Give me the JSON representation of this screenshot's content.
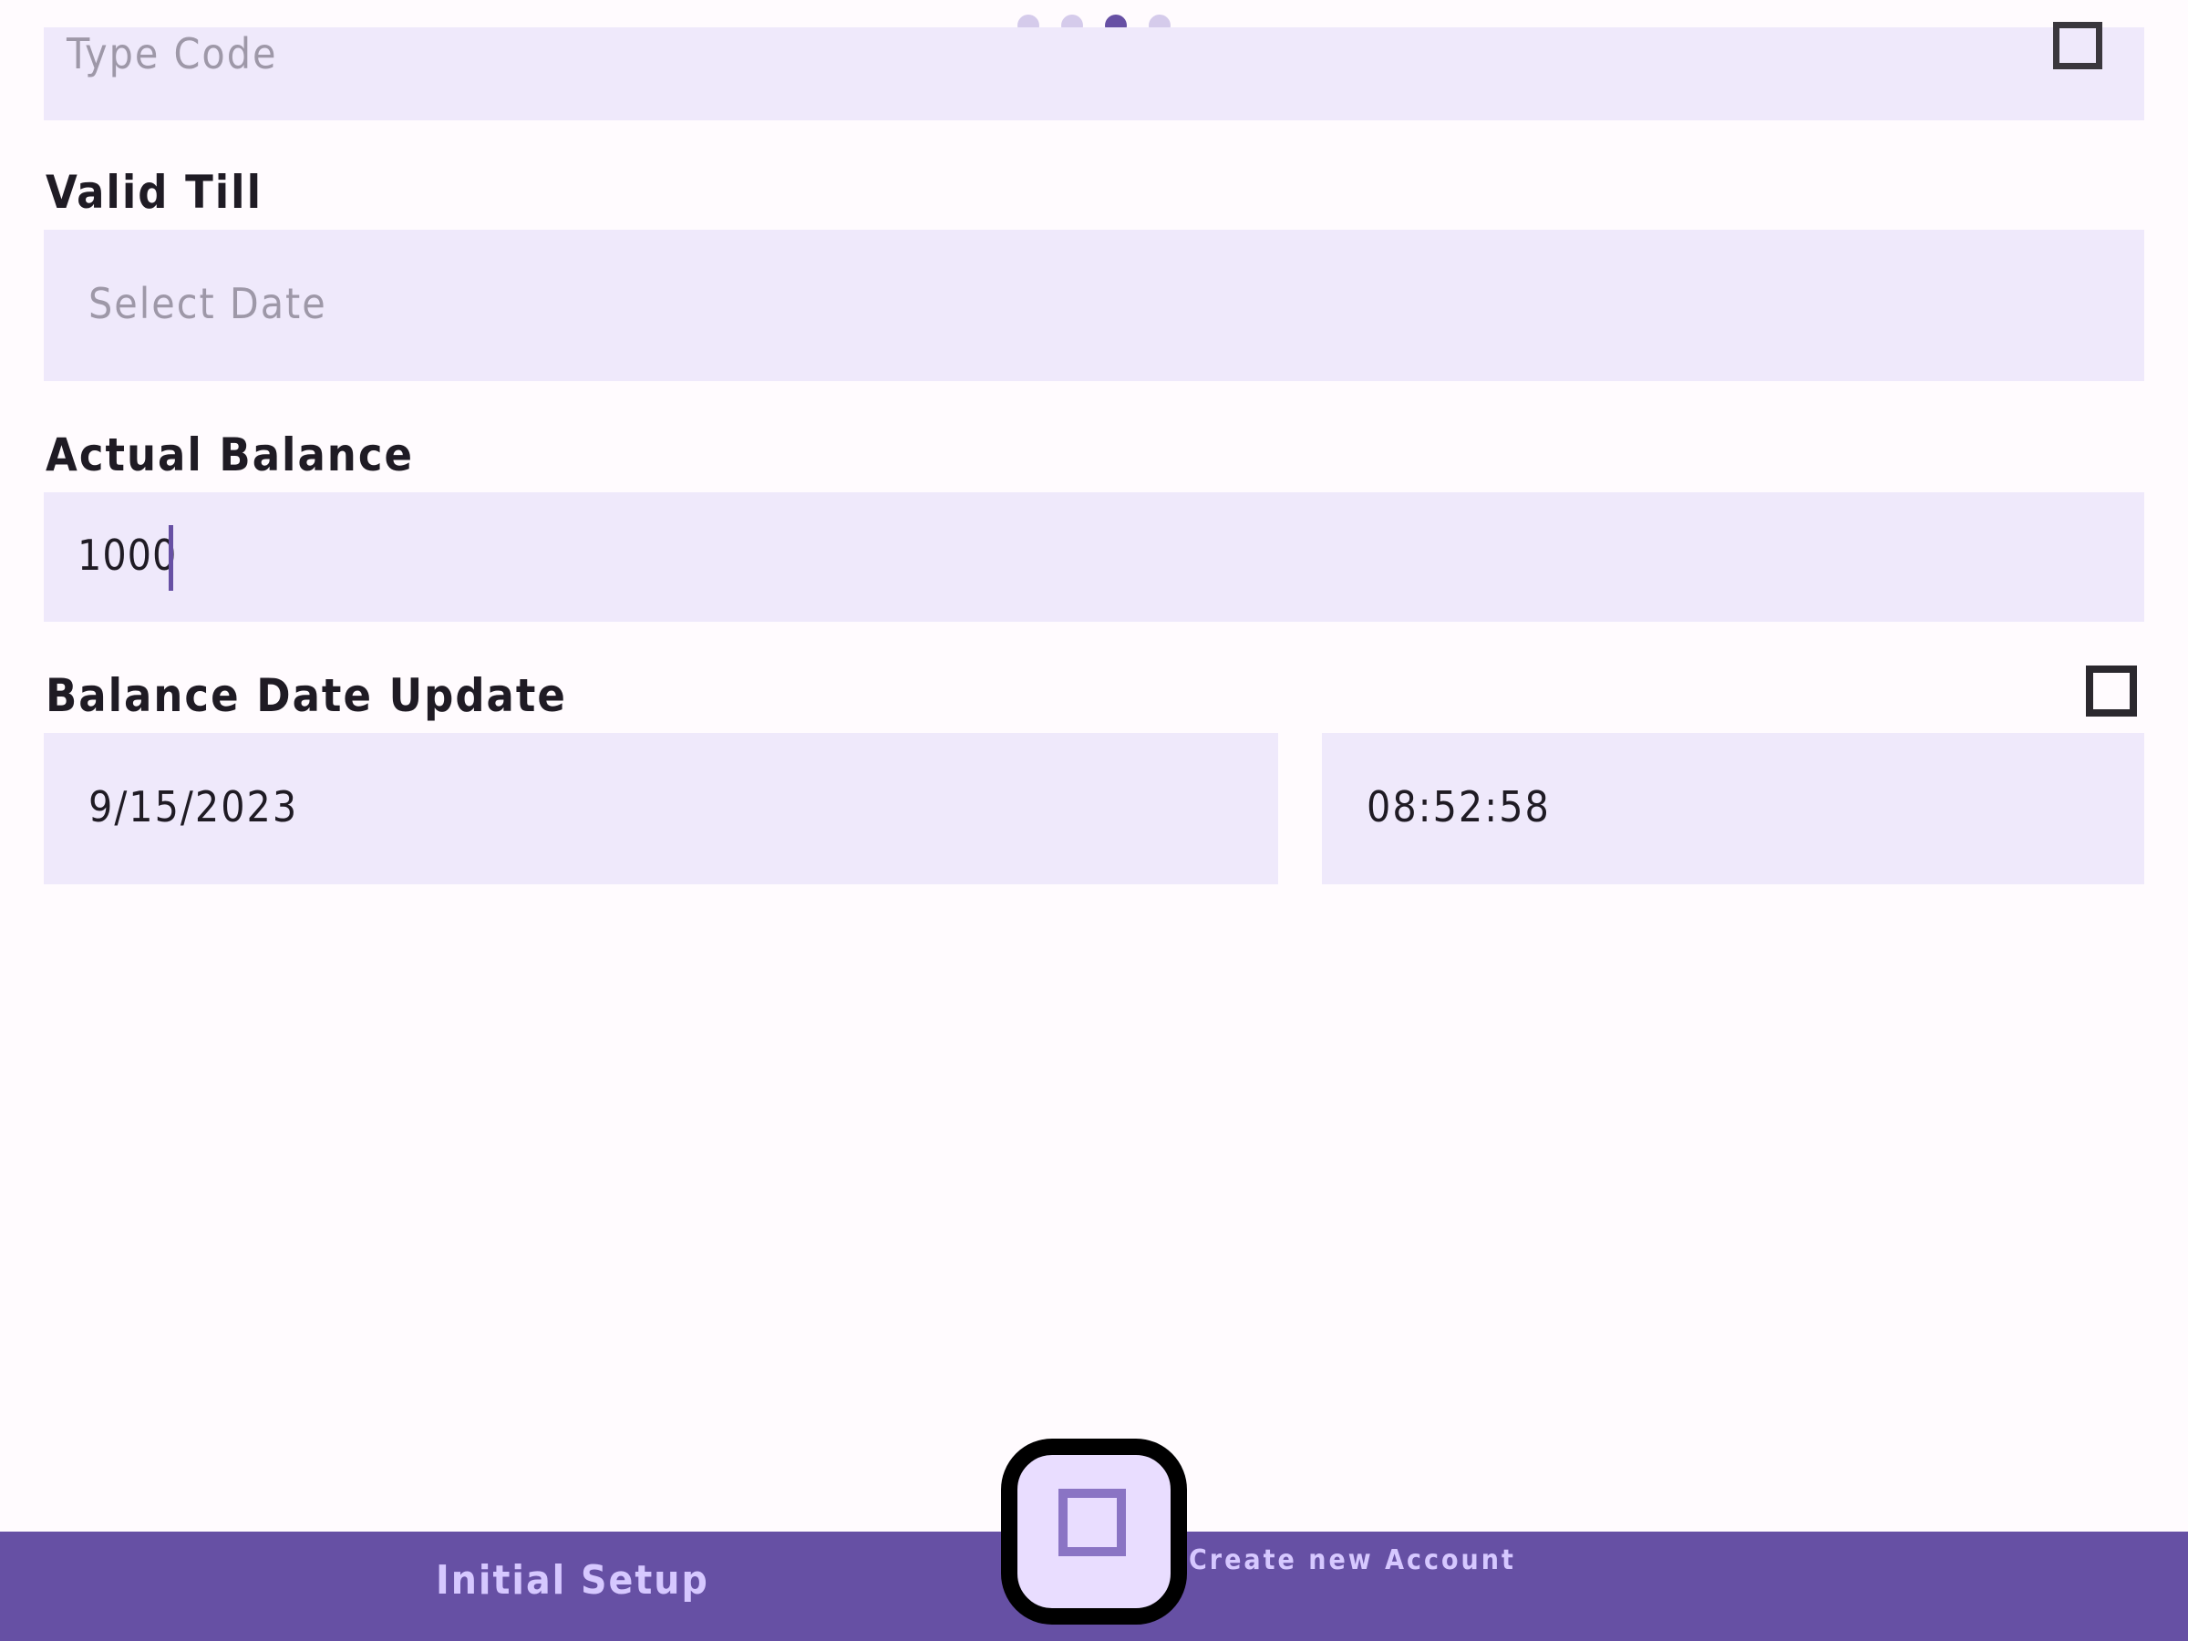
{
  "page_indicator": {
    "total": 4,
    "active_index": 2
  },
  "type_code": {
    "placeholder": "Type Code"
  },
  "valid_till": {
    "label": "Valid Till",
    "placeholder": "Select Date"
  },
  "actual_balance": {
    "label": "Actual Balance",
    "value": "1000"
  },
  "balance_date_update": {
    "label": "Balance Date Update",
    "date": "9/15/2023",
    "time": "08:52:58"
  },
  "bottom_nav": {
    "left_label": "Initial Setup",
    "right_label": "Create new Account"
  },
  "colors": {
    "accent": "#6750A4",
    "field_bg": "#EFE9FB",
    "bottom_bar": "#6650A4",
    "background": "#FFFBFE"
  }
}
